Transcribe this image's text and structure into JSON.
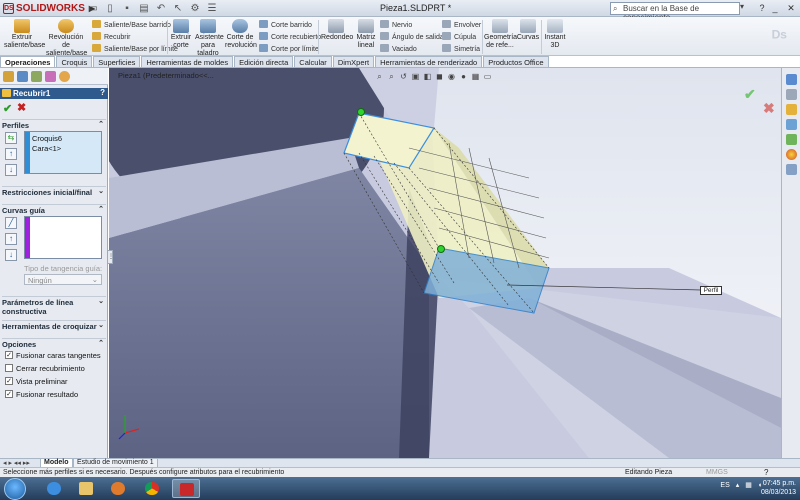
{
  "title_bar": {
    "logo_text": "SOLIDWORKS",
    "document_title": "Pieza1.SLDPRT *",
    "search_placeholder": "Buscar en la Base de conocimiento",
    "window_buttons": [
      "minimize-icon",
      "restore-icon",
      "close-icon"
    ]
  },
  "command_manager": {
    "big_buttons": [
      {
        "label": "Extruir saliente/base",
        "icon": "extrude-boss-icon"
      },
      {
        "label": "Revolución de saliente/base",
        "icon": "revolve-boss-icon"
      },
      {
        "label": "Extruir corte",
        "icon": "extrude-cut-icon"
      },
      {
        "label": "Asistente para taladro",
        "icon": "hole-wizard-icon"
      },
      {
        "label": "Corte de revolución",
        "icon": "revolve-cut-icon"
      },
      {
        "label": "Redondeo",
        "icon": "fillet-icon"
      },
      {
        "label": "Matriz lineal",
        "icon": "linear-pattern-icon"
      },
      {
        "label": "Geometría de refe...",
        "icon": "reference-geometry-icon"
      },
      {
        "label": "Curvas",
        "icon": "curves-icon"
      },
      {
        "label": "Instant 3D",
        "icon": "instant3d-icon"
      }
    ],
    "small_buttons_col1": [
      "Saliente/Base barrido",
      "Recubrir",
      "Saliente/Base por límite"
    ],
    "small_buttons_col2": [
      "Corte barrido",
      "Corte recubierto",
      "Corte por límite"
    ],
    "small_buttons_col3": [
      "Nervio",
      "Ángulo de salida",
      "Vaciado"
    ],
    "small_buttons_col4": [
      "Envolver",
      "Cúpula",
      "Simetría"
    ]
  },
  "tabs": [
    "Operaciones",
    "Croquis",
    "Superficies",
    "Herramientas de moldes",
    "Edición directa",
    "Calcular",
    "DimXpert",
    "Herramientas de renderizado",
    "Productos Office"
  ],
  "active_tab": "Operaciones",
  "property_manager": {
    "title": "Recubrir1",
    "help": "?",
    "groups": {
      "perfiles": "Perfiles",
      "restricciones": "Restricciones inicial/final",
      "curvas_guia": "Curvas guía",
      "parametros": "Parámetros de línea constructiva",
      "herramientas_croquizar": "Herramientas de croquizar",
      "opciones": "Opciones"
    },
    "profiles": [
      "Croquis6",
      "Cara<1>"
    ],
    "tangency_label": "Tipo de tangencia guía:",
    "tangency_value": "Ningún",
    "options": [
      {
        "label": "Fusionar caras tangentes",
        "checked": true
      },
      {
        "label": "Cerrar recubrimiento",
        "checked": false
      },
      {
        "label": "Vista preliminar",
        "checked": true
      },
      {
        "label": "Fusionar resultado",
        "checked": true
      }
    ]
  },
  "viewport": {
    "breadcrumb": "Pieza1  (Predeterminado<<...",
    "callout": "Perfil"
  },
  "bottom_tabs": [
    "Modelo",
    "Estudio de movimiento 1"
  ],
  "active_bottom_tab": "Modelo",
  "status": {
    "message": "Seleccione más perfiles si es necesario. Después configure atributos para el recubrimiento",
    "mode": "Editando Pieza",
    "units": "MMGS"
  },
  "taskbar": {
    "language": "ES",
    "time": "07:45 p.m.",
    "date": "08/03/2013"
  }
}
